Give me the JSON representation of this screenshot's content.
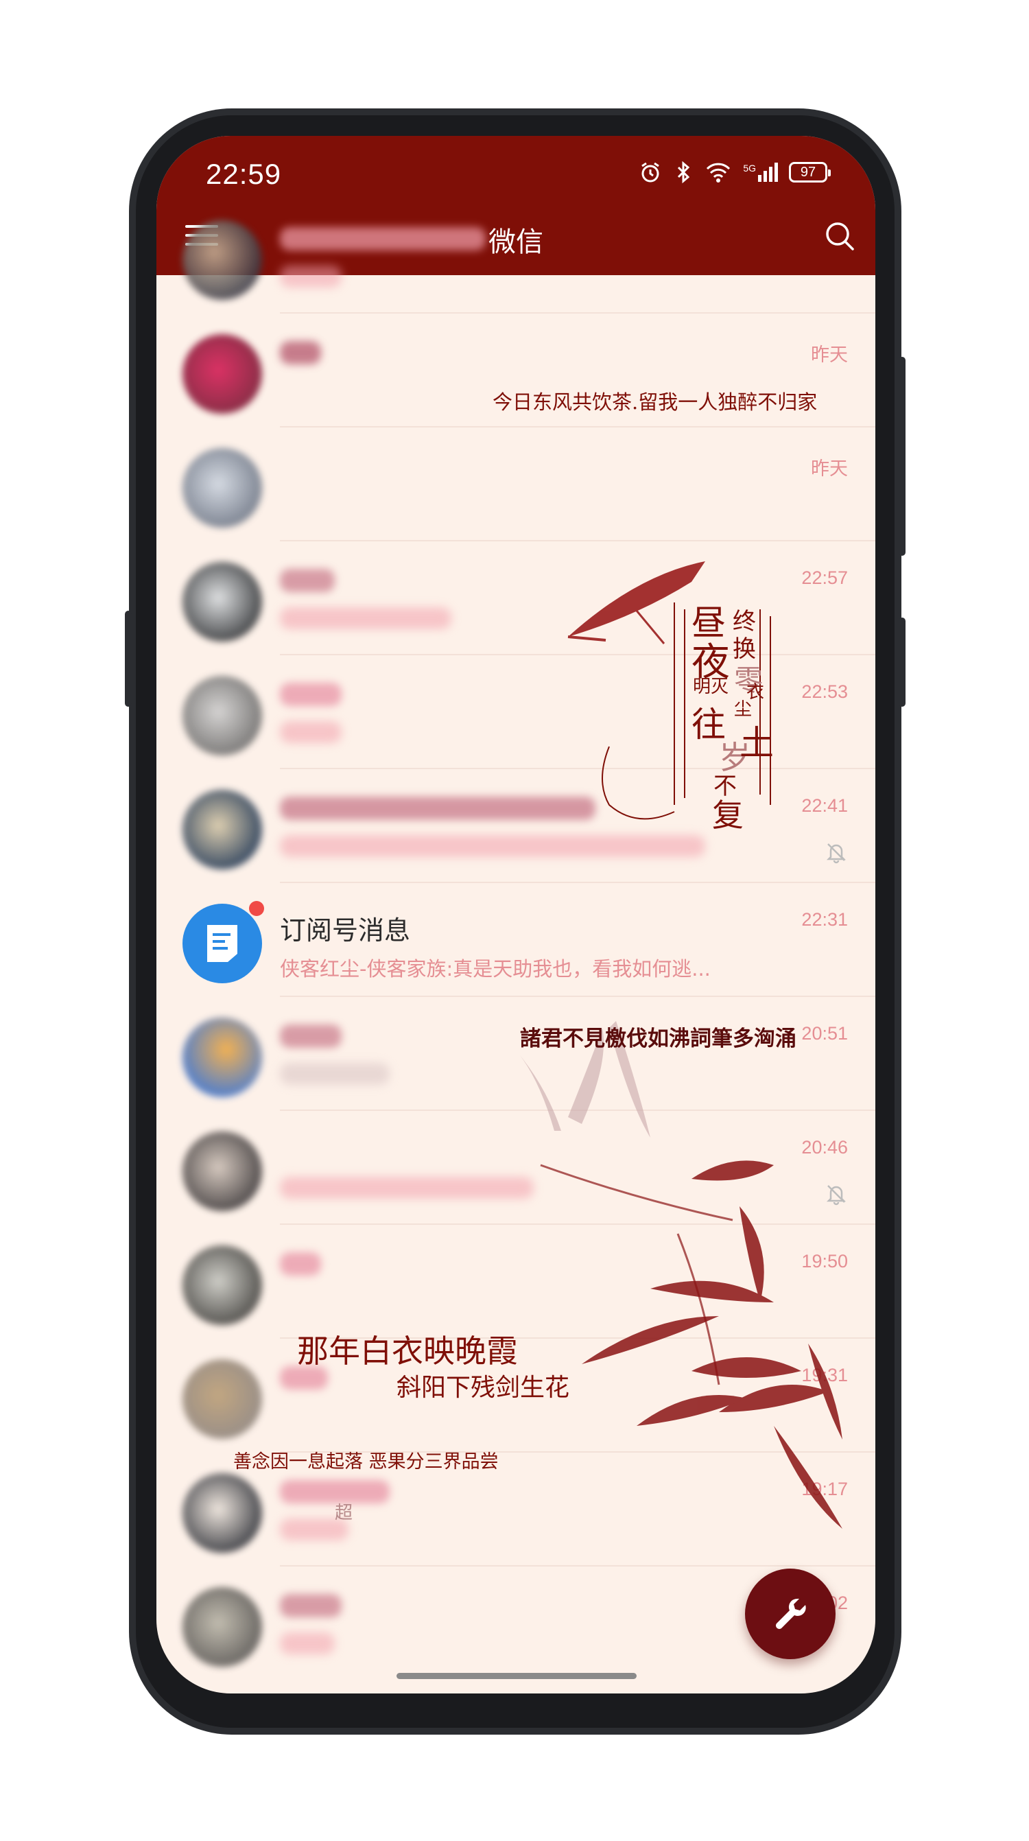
{
  "status_bar": {
    "time": "22:59",
    "network": "5G",
    "battery": "97"
  },
  "app_bar": {
    "title": "微信"
  },
  "chats": [
    {
      "time": ""
    },
    {
      "time": "昨天"
    },
    {
      "time": "昨天"
    },
    {
      "time": "22:57"
    },
    {
      "time": "22:53"
    },
    {
      "time": "22:41",
      "muted": true
    },
    {
      "time": "22:31"
    },
    {
      "time": "20:51"
    },
    {
      "time": "20:46",
      "muted": true
    },
    {
      "time": "19:50"
    },
    {
      "time": "19:31"
    },
    {
      "time": "19:17"
    },
    {
      "time": "19:02"
    }
  ],
  "subscription": {
    "name": "订阅号消息",
    "preview": "侠客红尘-侠客家族:真是天助我也，看我如何逃..."
  },
  "wallpaper_text": {
    "line1": "今日东风共饮茶.留我一人独醉不归家",
    "calligraphy": [
      "昼",
      "夜",
      "明",
      "灭",
      "往",
      "岁",
      "不",
      "复",
      "终",
      "换",
      "零",
      "衣",
      "尘",
      "土"
    ],
    "line2": "諸君不見檄伐如沸詞筆多洶涌",
    "line3a": "那年白衣映晚霞",
    "line3b": "斜阳下残剑生花",
    "line4": "善念因一息起落  恶果分三界品尝",
    "row12_fragment": "超"
  },
  "colors": {
    "app_bar": "#7f0f07",
    "background": "#fdf1e9",
    "timestamp": "#e58e93",
    "fab": "#6d0e12",
    "badge": "#f04a46",
    "subscription_icon": "#2a8ae4"
  },
  "icons": {
    "menu": "menu-icon",
    "search": "search-icon",
    "mute": "bell-off-icon",
    "fab": "wrench-icon"
  }
}
